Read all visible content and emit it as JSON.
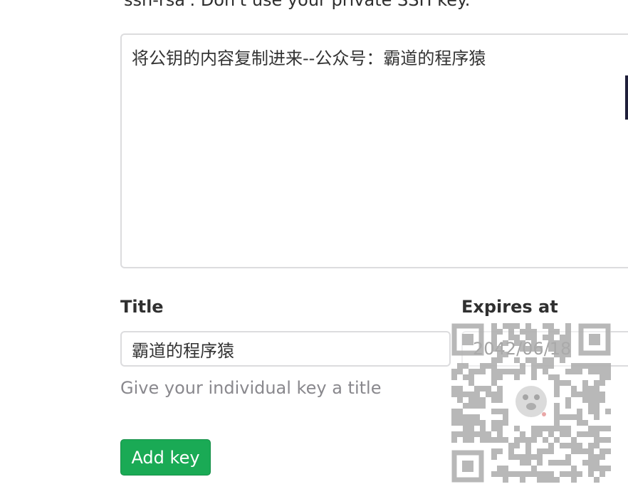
{
  "hint": {
    "text": "ssh-rsa'. Don't use your private SSH key."
  },
  "key_field": {
    "value": "将公钥的内容复制进来--公众号：霸道的程序猿"
  },
  "title_field": {
    "label": "Title",
    "value": "霸道的程序猿",
    "help": "Give your individual key a title"
  },
  "expires_field": {
    "label": "Expires at",
    "value": "2042/06/18"
  },
  "add_key_button": {
    "label": "Add key",
    "color": "#1aaa55"
  },
  "qr_code": {
    "icon": "qr-code-icon"
  }
}
